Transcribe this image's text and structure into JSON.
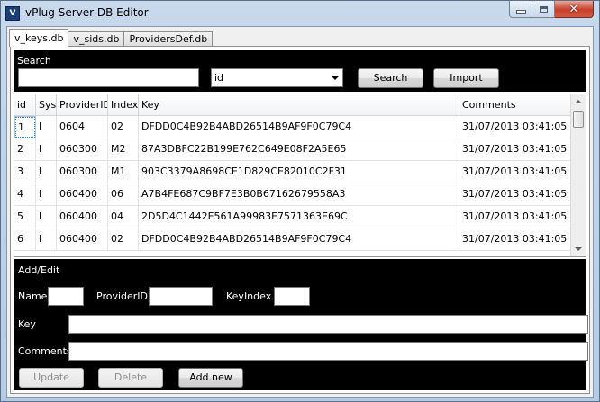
{
  "window": {
    "title": "vPlug Server DB Editor",
    "icon_name": "app-logo-icon",
    "icon_text": "V",
    "min_glyph_name": "minimize-icon",
    "max_glyph_name": "maximize-icon",
    "close_glyph": "✕"
  },
  "tabs": [
    {
      "label": "v_keys.db",
      "active": true
    },
    {
      "label": "v_sids.db",
      "active": false
    },
    {
      "label": "ProvidersDef.db",
      "active": false
    }
  ],
  "search": {
    "section_label": "Search",
    "query_value": "",
    "field_select_value": "id",
    "search_button": "Search",
    "import_button": "Import"
  },
  "grid": {
    "columns": [
      "id",
      "Sys",
      "ProviderID",
      "Index",
      "Key",
      "Comments"
    ],
    "rows": [
      [
        "1",
        "I",
        "0604",
        "02",
        "DFDD0C4B92B4ABD26514B9AF9F0C79C4",
        "31/07/2013 03:41:05"
      ],
      [
        "2",
        "I",
        "060300",
        "M2",
        "87A3DBFC22B199E762C649E08F2A5E65",
        "31/07/2013 03:41:05"
      ],
      [
        "3",
        "I",
        "060300",
        "M1",
        "903C3379A8698CE1D829CE82010C2F31",
        "31/07/2013 03:41:05"
      ],
      [
        "4",
        "I",
        "060400",
        "06",
        "A7B4FE687C9BF7E3B0B67162679558A3",
        "31/07/2013 03:41:05"
      ],
      [
        "5",
        "I",
        "060400",
        "04",
        "2D5D4C1442E561A99983E7571363E69C",
        "31/07/2013 03:41:05"
      ],
      [
        "6",
        "I",
        "060400",
        "02",
        "DFDD0C4B92B4ABD26514B9AF9F0C79C4",
        "31/07/2013 03:41:05"
      ]
    ]
  },
  "edit": {
    "section_label": "Add/Edit",
    "name_label": "Name",
    "name_value": "",
    "provider_label": "ProviderID",
    "provider_value": "",
    "keyindex_label": "KeyIndex",
    "keyindex_value": "",
    "key_label": "Key",
    "key_value": "",
    "comments_label": "Comments",
    "comments_value": "",
    "update_button": "Update",
    "delete_button": "Delete",
    "addnew_button": "Add new"
  }
}
